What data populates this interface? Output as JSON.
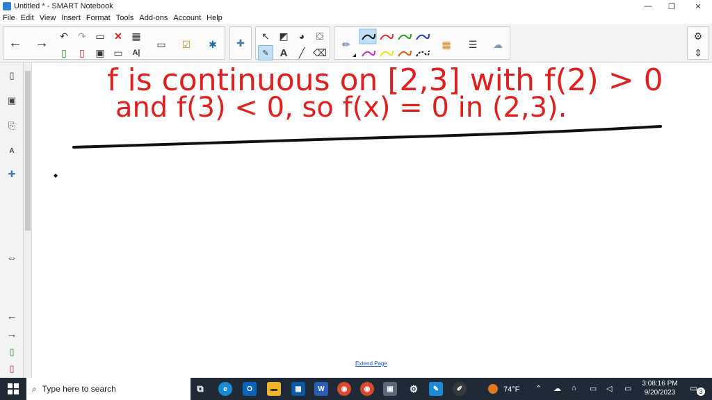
{
  "window": {
    "title": "Untitled * - SMART Notebook",
    "minimize": "—",
    "restore": "❐",
    "close": "✕"
  },
  "menu": [
    "File",
    "Edit",
    "View",
    "Insert",
    "Format",
    "Tools",
    "Add-ons",
    "Account",
    "Help"
  ],
  "pen_colors": {
    "row1": [
      "#1a1a1a",
      "#e03030",
      "#2a9a2a",
      "#2a3ad0"
    ],
    "row2": [
      "#c030c0",
      "#e8e020",
      "#e05a10",
      "#1a1a1a"
    ]
  },
  "canvas": {
    "handwriting_line1": "f is continuous on [2,3] with f(2) > 0",
    "handwriting_line2": "and f(3) < 0, so f(x) = 0 in (2,3).",
    "ink_color": "#e01f1f"
  },
  "page": {
    "extend_link": "Extend Page"
  },
  "taskbar": {
    "search_placeholder": "Type here to search",
    "weather": "74°F",
    "time": "3:08:16 PM",
    "date": "9/20/2023",
    "notification_count": "3"
  }
}
